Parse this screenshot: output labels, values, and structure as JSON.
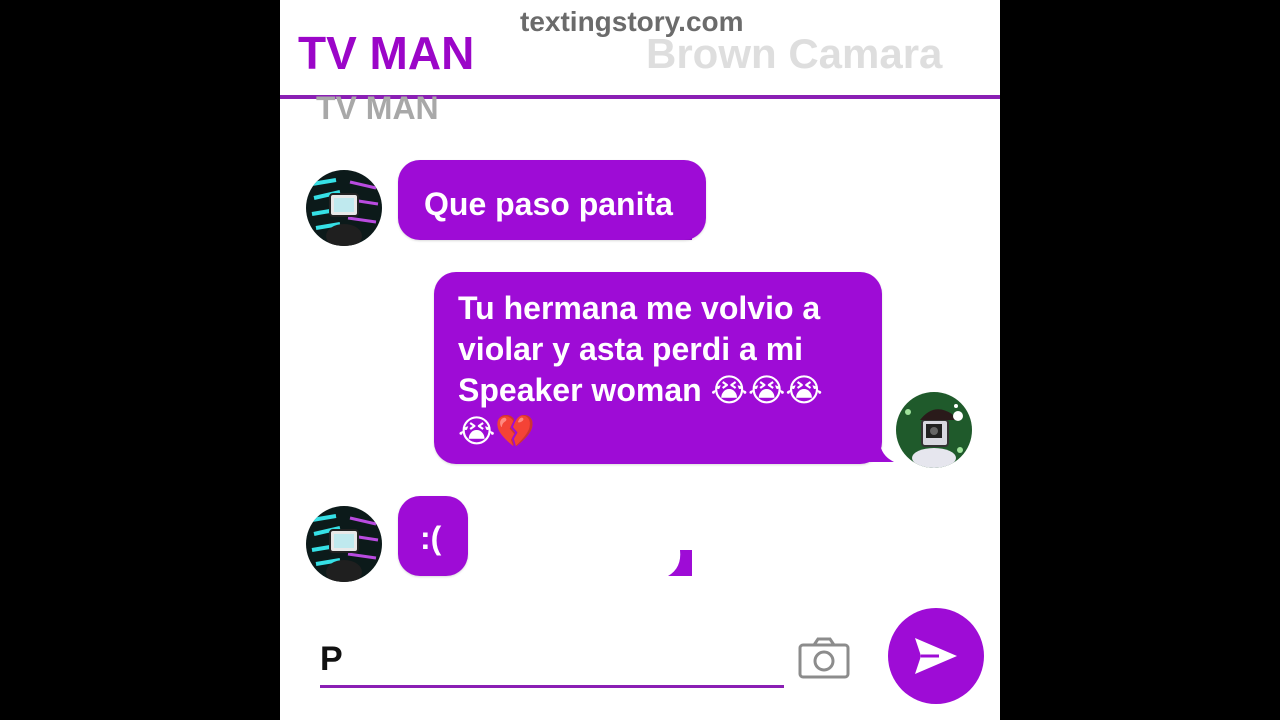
{
  "watermark": "textingstory.com",
  "header": {
    "contact_name": "TV MAN",
    "other_name_faded": "Brown Camara"
  },
  "ghost_name": "TV MAN",
  "colors": {
    "accent": "#9e0cd6",
    "header_line": "#8a1fb4",
    "bubble_text": "#ffffff"
  },
  "messages": [
    {
      "sender": "TV MAN",
      "side": "left",
      "text": "Que paso panita"
    },
    {
      "sender": "me",
      "side": "right",
      "lines": [
        "Tu hermana me volvio a",
        "violar y asta perdi a mi",
        "Speaker woman 😭😭😭",
        "😭💔"
      ]
    },
    {
      "sender": "TV MAN",
      "side": "left",
      "text": ":("
    }
  ],
  "composer": {
    "value": "P"
  },
  "icons": {
    "camera": "camera-icon",
    "send": "send-icon",
    "avatar_tv_man": "tv-man-avatar",
    "avatar_me": "camera-man-avatar"
  }
}
